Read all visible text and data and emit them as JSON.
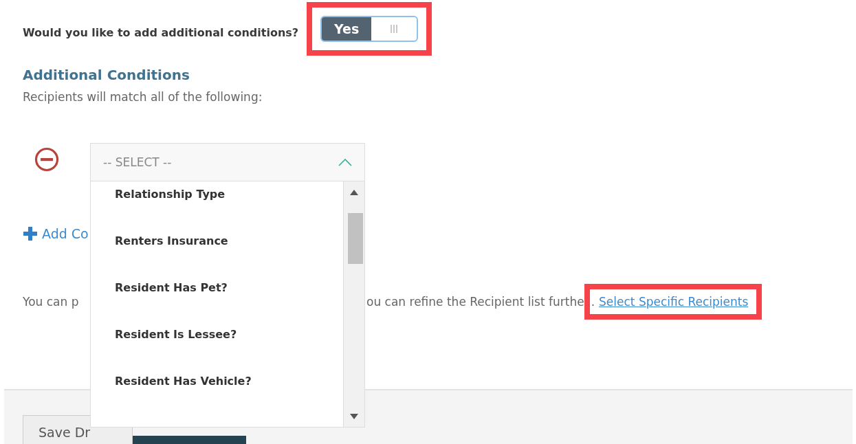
{
  "question": {
    "label": "Would you like to add additional conditions?",
    "toggle": {
      "on": true,
      "label": "Yes",
      "highlighted": true
    }
  },
  "section": {
    "heading": "Additional Conditions",
    "subtitle": "Recipients will match all of the following:"
  },
  "condition": {
    "select": {
      "placeholder": "-- SELECT --",
      "expanded": true,
      "options": [
        "Relationship Type",
        "Renters Insurance",
        "Resident Has Pet?",
        "Resident Is Lessee?",
        "Resident Has Vehicle?"
      ]
    }
  },
  "add_condition": {
    "label": "Add Co"
  },
  "note": {
    "text_start": "You can p",
    "text_end": "ou can refine the Recipient list furthe",
    "period": ".",
    "link": {
      "label": "Select Specific Recipients",
      "highlighted": true
    }
  },
  "footer": {
    "buttons": [
      {
        "kind": "secondary",
        "label": "Save Dr"
      },
      {
        "kind": "primary"
      }
    ]
  }
}
